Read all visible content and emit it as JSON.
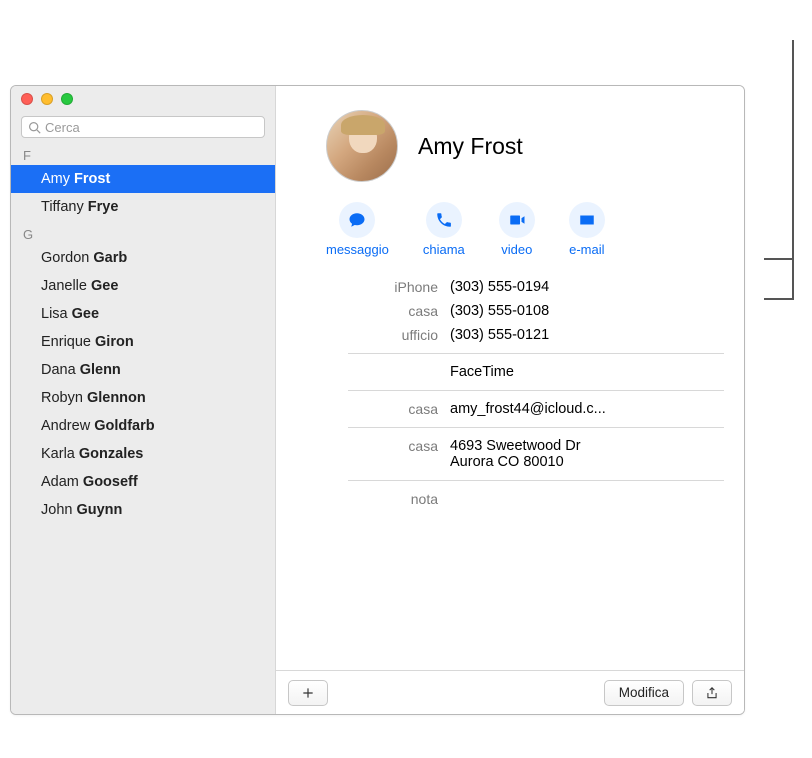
{
  "search": {
    "placeholder": "Cerca"
  },
  "sections": {
    "F": {
      "label": "F",
      "items": [
        {
          "first": "Amy",
          "last": "Frost",
          "selected": true
        },
        {
          "first": "Tiffany",
          "last": "Frye",
          "selected": false
        }
      ]
    },
    "G": {
      "label": "G",
      "items": [
        {
          "first": "Gordon",
          "last": "Garb"
        },
        {
          "first": "Janelle",
          "last": "Gee"
        },
        {
          "first": "Lisa",
          "last": "Gee"
        },
        {
          "first": "Enrique",
          "last": "Giron"
        },
        {
          "first": "Dana",
          "last": "Glenn"
        },
        {
          "first": "Robyn",
          "last": "Glennon"
        },
        {
          "first": "Andrew",
          "last": "Goldfarb"
        },
        {
          "first": "Karla",
          "last": "Gonzales"
        },
        {
          "first": "Adam",
          "last": "Gooseff"
        },
        {
          "first": "John",
          "last": "Guynn"
        }
      ]
    }
  },
  "detail": {
    "name": "Amy Frost",
    "actions": {
      "message": "messaggio",
      "call": "chiama",
      "video": "video",
      "email": "e-mail"
    },
    "phones": [
      {
        "label": "iPhone",
        "value": "(303) 555-0194"
      },
      {
        "label": "casa",
        "value": "(303) 555-0108"
      },
      {
        "label": "ufficio",
        "value": "(303) 555-0121"
      }
    ],
    "facetime": {
      "label": "",
      "value": "FaceTime"
    },
    "email": {
      "label": "casa",
      "value": "amy_frost44@icloud.c..."
    },
    "address": {
      "label": "casa",
      "line1": "4693 Sweetwood Dr",
      "line2": "Aurora CO 80010"
    },
    "note": {
      "label": "nota"
    }
  },
  "buttons": {
    "edit": "Modifica"
  }
}
